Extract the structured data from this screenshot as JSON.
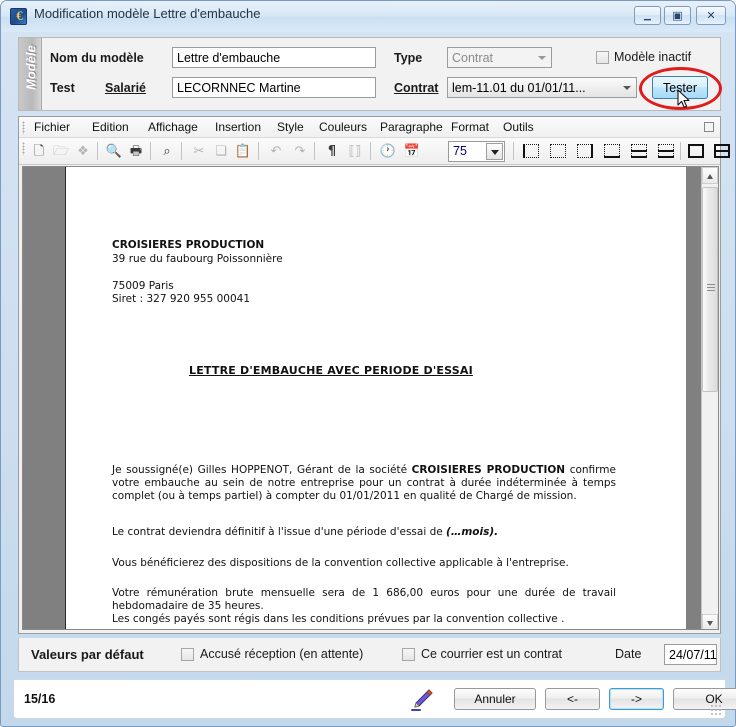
{
  "window": {
    "title": "Modification modèle Lettre d'embauche",
    "icon": "app-euro-icon",
    "controls": {
      "minimize": "–",
      "maximize": "❐",
      "close": "✕"
    }
  },
  "model_panel": {
    "vertical_tab": "Modèle",
    "name_label": "Nom du modèle",
    "name_value": "Lettre d'embauche",
    "type_label": "Type",
    "type_value": "Contrat",
    "inactive_checkbox_label": "Modèle inactif",
    "inactive_checked": false,
    "test_label": "Test",
    "employee_link": "Salarié",
    "employee_value": "LECORNNEC Martine",
    "contract_link": "Contrat",
    "contract_value": "lem-11.01 du 01/01/11...",
    "tester_button": "Tester",
    "annotation": "red-ellipse-highlight"
  },
  "editor": {
    "menu": [
      "Fichier",
      "Edition",
      "Affichage",
      "Insertion",
      "Style",
      "Couleurs",
      "Paragraphe",
      "Format",
      "Outils"
    ],
    "zoom_value": "75",
    "toolbar_icons": [
      "new-document-icon",
      "open-folder-icon",
      "save-icon",
      "print-preview-icon",
      "print-icon",
      "zoom-search-icon",
      "cut-icon",
      "copy-icon",
      "paste-icon",
      "undo-icon",
      "redo-icon",
      "pilcrow-icon",
      "special-chars-icon",
      "clock-icon",
      "calendar-icon"
    ],
    "frame_icons": [
      "border-left-icon",
      "border-none-icon",
      "border-right-icon",
      "border-bottom-icon",
      "border-split-top-icon",
      "border-split-bottom-icon",
      "border-full-icon",
      "border-full-split-icon",
      "border-dotted-icon"
    ]
  },
  "document": {
    "company": "CROISIERES PRODUCTION",
    "address1": "39 rue du faubourg Poissonnière",
    "address2": "75009 Paris",
    "siret": "Siret : 327 920 955 00041",
    "title": "LETTRE D'EMBAUCHE AVEC PERIODE D'ESSAI",
    "para1_pre": "Je soussigné(e) Gilles HOPPENOT, Gérant de la société ",
    "para1_bold": "CROISIERES PRODUCTION",
    "para1_post": " confirme votre embauche au sein de notre entreprise pour un contrat à durée indéterminée à temps complet (ou à temps partiel) à compter du 01/01/2011 en qualité de Chargé de mission.",
    "para2_pre": "Le contrat deviendra définitif à l'issue d'une période d'essai de ",
    "para2_bold": "(…mois).",
    "para3": "Vous bénéficierez des dispositions de la convention collective  applicable à l'entreprise.",
    "para4": "Votre rémunération brute mensuelle sera de 1 686,00 euros pour une durée de  travail hebdomadaire de 35 heures.",
    "para5": "Les congés payés sont régis dans les conditions prévues par la convention collective ."
  },
  "defaults": {
    "title": "Valeurs par défaut",
    "ack_label": "Accusé réception (en attente)",
    "ack_checked": false,
    "contract_label": "Ce courrier est un contrat",
    "contract_checked": false,
    "date_label": "Date",
    "date_value": "24/07/11"
  },
  "statusbar": {
    "page_counter": "15/16",
    "pen_icon": "pen-signature-icon",
    "cancel": "Annuler",
    "prev": "<-",
    "next": "->",
    "ok": "OK"
  }
}
